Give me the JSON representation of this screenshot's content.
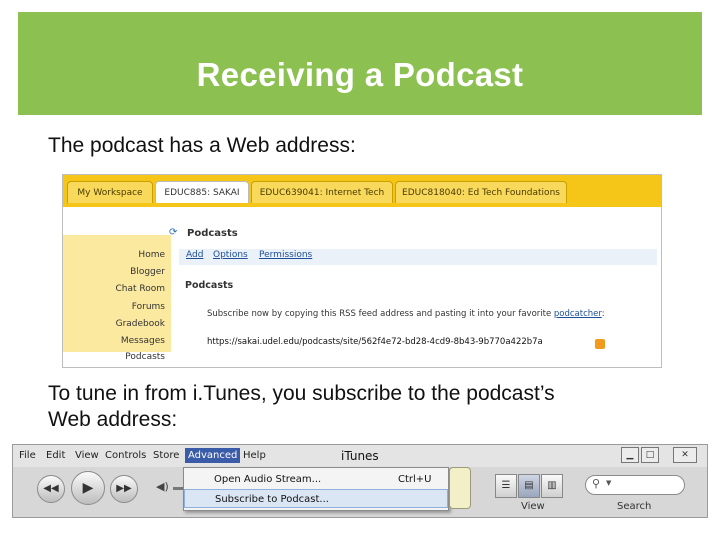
{
  "slide": {
    "title": "Receiving a Podcast",
    "text1": "The podcast has a Web address:",
    "text2_line1": "To tune in from i.Tunes, you subscribe to the podcast’s",
    "text2_line2": "Web address:"
  },
  "colors": {
    "banner": "#8cc152",
    "sakai_yellow": "#f5c518",
    "itunes_highlight": "#3a5ba8"
  },
  "sakai": {
    "tabs": [
      "My Workspace",
      "EDUC885: SAKAI",
      "EDUC639041: Internet Tech",
      "EDUC818040: Ed Tech Foundations"
    ],
    "active_tab": "EDUC885: SAKAI",
    "left_nav": [
      "Home",
      "Blogger",
      "Chat Room",
      "Forums",
      "Gradebook",
      "Messages",
      "Podcasts"
    ],
    "active_nav": "Podcasts",
    "tool_title": "Podcasts",
    "tool_icon": "refresh-icon",
    "links": [
      "Add",
      "Options",
      "Permissions"
    ],
    "heading": "Podcasts",
    "description_prefix": "Subscribe now by copying this RSS feed address and pasting it into your favorite ",
    "description_link": "podcatcher",
    "description_suffix": ":",
    "feed_url": "https://sakai.udel.edu/podcasts/site/562f4e72-bd28-4cd9-8b43-9b770a422b7a",
    "rss_icon": "rss-icon"
  },
  "itunes": {
    "menus": [
      "File",
      "Edit",
      "View",
      "Controls",
      "Store",
      "Advanced",
      "Help"
    ],
    "active_menu": "Advanced",
    "window_title": "iTunes",
    "window_controls": [
      "minimize-icon",
      "maximize-icon",
      "close-icon"
    ],
    "dropdown": [
      {
        "label": "Open Audio Stream...",
        "shortcut": "Ctrl+U"
      },
      {
        "label": "Subscribe to Podcast...",
        "shortcut": ""
      }
    ],
    "bottom_labels": {
      "view": "View",
      "search": "Search"
    }
  }
}
